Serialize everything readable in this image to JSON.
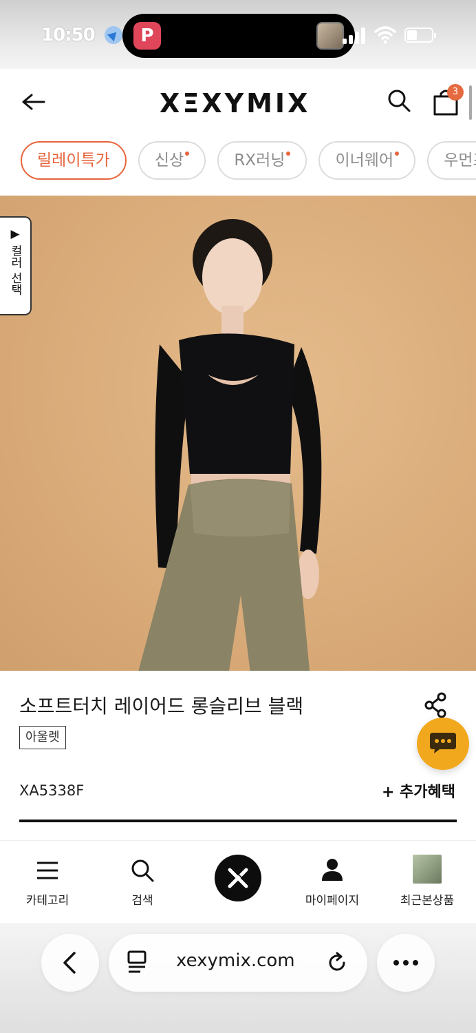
{
  "status_bar": {
    "time": "10:50"
  },
  "header": {
    "logo": "XΞXYMIX",
    "cart_count": "3"
  },
  "chips": [
    {
      "label": "릴레이특가",
      "active": true,
      "dot": false
    },
    {
      "label": "신상",
      "active": false,
      "dot": true
    },
    {
      "label": "RX러닝",
      "active": false,
      "dot": true
    },
    {
      "label": "이너웨어",
      "active": false,
      "dot": true
    },
    {
      "label": "우먼즈",
      "active": false,
      "dot": false
    }
  ],
  "hero": {
    "color_select_label": "▶ 컬러 선택"
  },
  "product": {
    "title": "소프트터치 레이어드 롱슬리브 블랙",
    "badge": "아울렛",
    "sku": "XA5338F",
    "extra_benefit": "+ 추가혜택"
  },
  "bottom_nav": {
    "category": "카테고리",
    "search": "검색",
    "mypage": "마이페이지",
    "recent": "최근본상품"
  },
  "browser": {
    "url": "xexymix.com"
  },
  "colors": {
    "accent": "#e8643b",
    "chat": "#f2a81d",
    "hero_bg": "#dcae7c"
  }
}
